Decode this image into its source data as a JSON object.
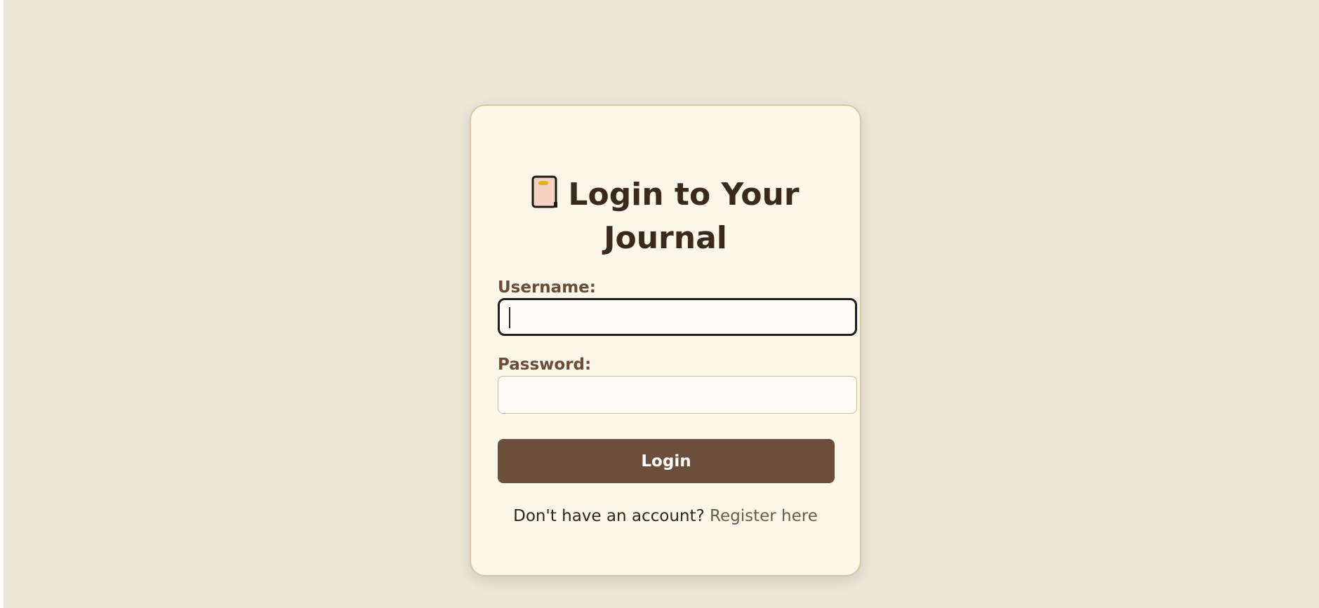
{
  "login_card": {
    "title_line_1": "Login to Your",
    "title_line_2": "Journal",
    "title_icon": "journal-notebook-icon",
    "username_label": "Username:",
    "username_value": "",
    "password_label": "Password:",
    "password_value": "",
    "login_button_label": "Login",
    "footer_prompt": "Don't have an account?",
    "register_link_label": "Register here"
  },
  "colors": {
    "page_background": "#ede6d8",
    "card_background": "#fdf7ea",
    "card_border": "#d7c7a6",
    "title_text": "#3a2a1c",
    "label_text": "#6b4d37",
    "button_background": "#6b4f3c",
    "button_text": "#ffffff",
    "link_text": "#6b5a46"
  }
}
